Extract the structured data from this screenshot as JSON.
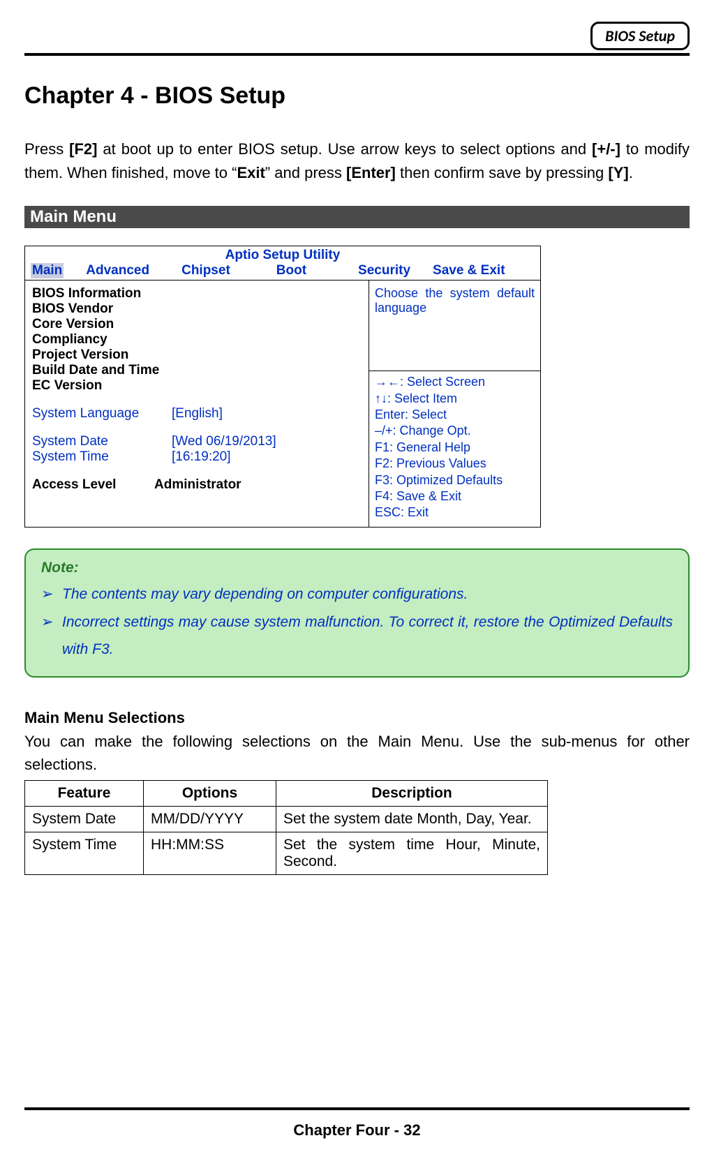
{
  "header": {
    "title": "BIOS Setup"
  },
  "chapter_title": "Chapter 4 - BIOS Setup",
  "intro": {
    "p1a": "Press ",
    "f2": "[F2]",
    "p1b": " at boot up to enter BIOS setup. Use arrow keys to select options and ",
    "pm": "[+/-]",
    "p1c": " to modify them. When finished, move to “",
    "exit": "Exit",
    "p1d": "” and press ",
    "enter": "[Enter]",
    "p1e": " then confirm save by pressing ",
    "y": "[Y]",
    "p1f": "."
  },
  "section_main": "Main Menu",
  "bios": {
    "utility_title": "Aptio Setup Utility",
    "tabs": [
      "Main",
      "Advanced",
      "Chipset",
      "Boot",
      "Security",
      "Save & Exit"
    ],
    "left_items": [
      "BIOS Information",
      "BIOS Vendor",
      "Core Version",
      "Compliancy",
      "Project Version",
      "Build Date and Time",
      "EC Version"
    ],
    "lang_label": "System Language",
    "lang_value": "[English]",
    "date_label": "System Date",
    "date_value": "[Wed 06/19/2013]",
    "time_label": "System Time",
    "time_value": "[16:19:20]",
    "access_label": "Access Level",
    "access_value": "Administrator",
    "help_text": "Choose the system default language",
    "keys": [
      "→←: Select Screen",
      "↑↓: Select Item",
      "Enter: Select",
      "–/+: Change Opt.",
      "F1: General Help",
      "F2: Previous Values",
      "F3: Optimized Defaults",
      "F4: Save & Exit",
      "ESC: Exit"
    ]
  },
  "note": {
    "label": "Note:",
    "items": [
      "The contents may vary depending on computer configurations.",
      "Incorrect settings may cause system malfunction. To correct it, restore the Optimized Defaults with F3."
    ]
  },
  "selections": {
    "heading": "Main Menu Selections",
    "text": "You can make the following selections on the Main Menu. Use the sub-menus for other selections.",
    "headers": [
      "Feature",
      "Options",
      "Description"
    ],
    "rows": [
      {
        "feature": "System Date",
        "options": "MM/DD/YYYY",
        "desc": "Set the system date Month, Day, Year."
      },
      {
        "feature": "System Time",
        "options": "HH:MM:SS",
        "desc": "Set the system time Hour, Minute, Second."
      }
    ]
  },
  "footer": "Chapter Four - 32",
  "bullet": "➢"
}
